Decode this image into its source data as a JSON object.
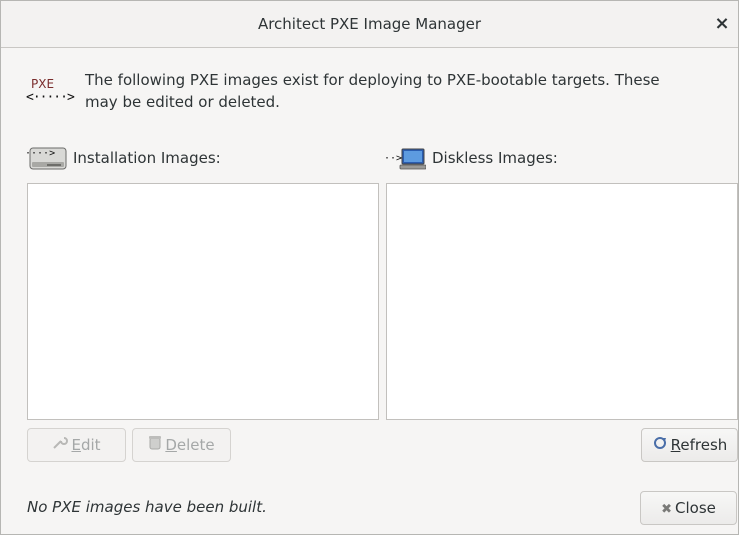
{
  "window": {
    "title": "Architect PXE Image Manager",
    "close_glyph": "×"
  },
  "intro": {
    "icon_label": "PXE",
    "icon_arrow": "<·····>",
    "line1": "The following PXE images exist for deploying to PXE-bootable targets.  These",
    "line2": "may be edited or deleted."
  },
  "sections": {
    "installation": {
      "label": "Installation Images:",
      "icon": "hard-drive-icon",
      "arrow": "····>"
    },
    "diskless": {
      "label": "Diskless Images:",
      "icon": "monitor-icon",
      "arrow": "··>"
    }
  },
  "buttons": {
    "edit": {
      "label_first": "E",
      "label_rest": "dit",
      "icon": "wrench-icon",
      "enabled": false
    },
    "delete": {
      "label_first": "D",
      "label_rest": "elete",
      "icon": "trash-icon",
      "enabled": false
    },
    "refresh": {
      "label_first": "R",
      "label_rest": "efresh",
      "icon": "refresh-icon",
      "enabled": true
    },
    "close": {
      "label": "Close",
      "icon": "close-icon",
      "enabled": true
    }
  },
  "status_text": "No PXE images have been built.",
  "colors": {
    "window_bg": "#f6f5f4",
    "list_bg": "#ffffff",
    "disabled_text": "#a5a8a8"
  }
}
